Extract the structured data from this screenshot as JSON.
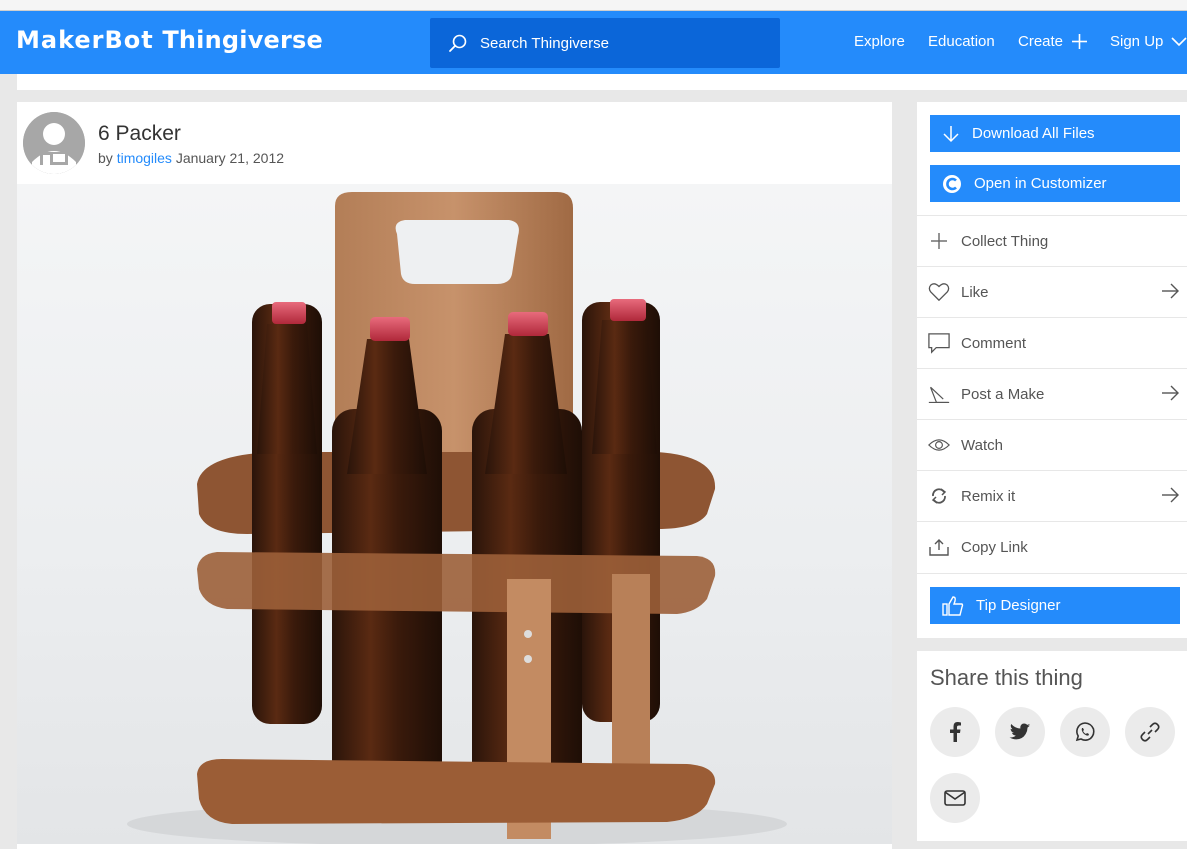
{
  "header": {
    "logo_maker": "MakerBot",
    "logo_thingiverse": "Thingiverse",
    "search_placeholder": "Search Thingiverse",
    "nav": {
      "explore": "Explore",
      "education": "Education",
      "create": "Create",
      "signup": "Sign Up"
    }
  },
  "thing": {
    "title": "6 Packer",
    "by_prefix": "by",
    "author": "timogiles",
    "date": "January 21, 2012",
    "image_subject": "laser-cut wooden six-pack bottle carrier holding four brown bottles"
  },
  "sidebar": {
    "download_label": "Download All Files",
    "customizer_label": "Open in Customizer",
    "actions": [
      {
        "label": "Collect Thing",
        "icon": "plus-icon",
        "arrow": false
      },
      {
        "label": "Like",
        "icon": "heart-icon",
        "arrow": true
      },
      {
        "label": "Comment",
        "icon": "comment-icon",
        "arrow": false
      },
      {
        "label": "Post a Make",
        "icon": "pencil-icon",
        "arrow": true
      },
      {
        "label": "Watch",
        "icon": "eye-icon",
        "arrow": false
      },
      {
        "label": "Remix it",
        "icon": "remix-icon",
        "arrow": true
      },
      {
        "label": "Copy Link",
        "icon": "share-upload-icon",
        "arrow": false
      }
    ],
    "tip_label": "Tip Designer"
  },
  "share": {
    "heading": "Share this thing",
    "buttons": [
      "facebook-icon",
      "twitter-icon",
      "whatsapp-icon",
      "link-icon",
      "email-icon"
    ]
  },
  "colors": {
    "brand_blue": "#248bfb",
    "search_blue": "#0b66d9",
    "page_bg": "#e8e8e8"
  }
}
